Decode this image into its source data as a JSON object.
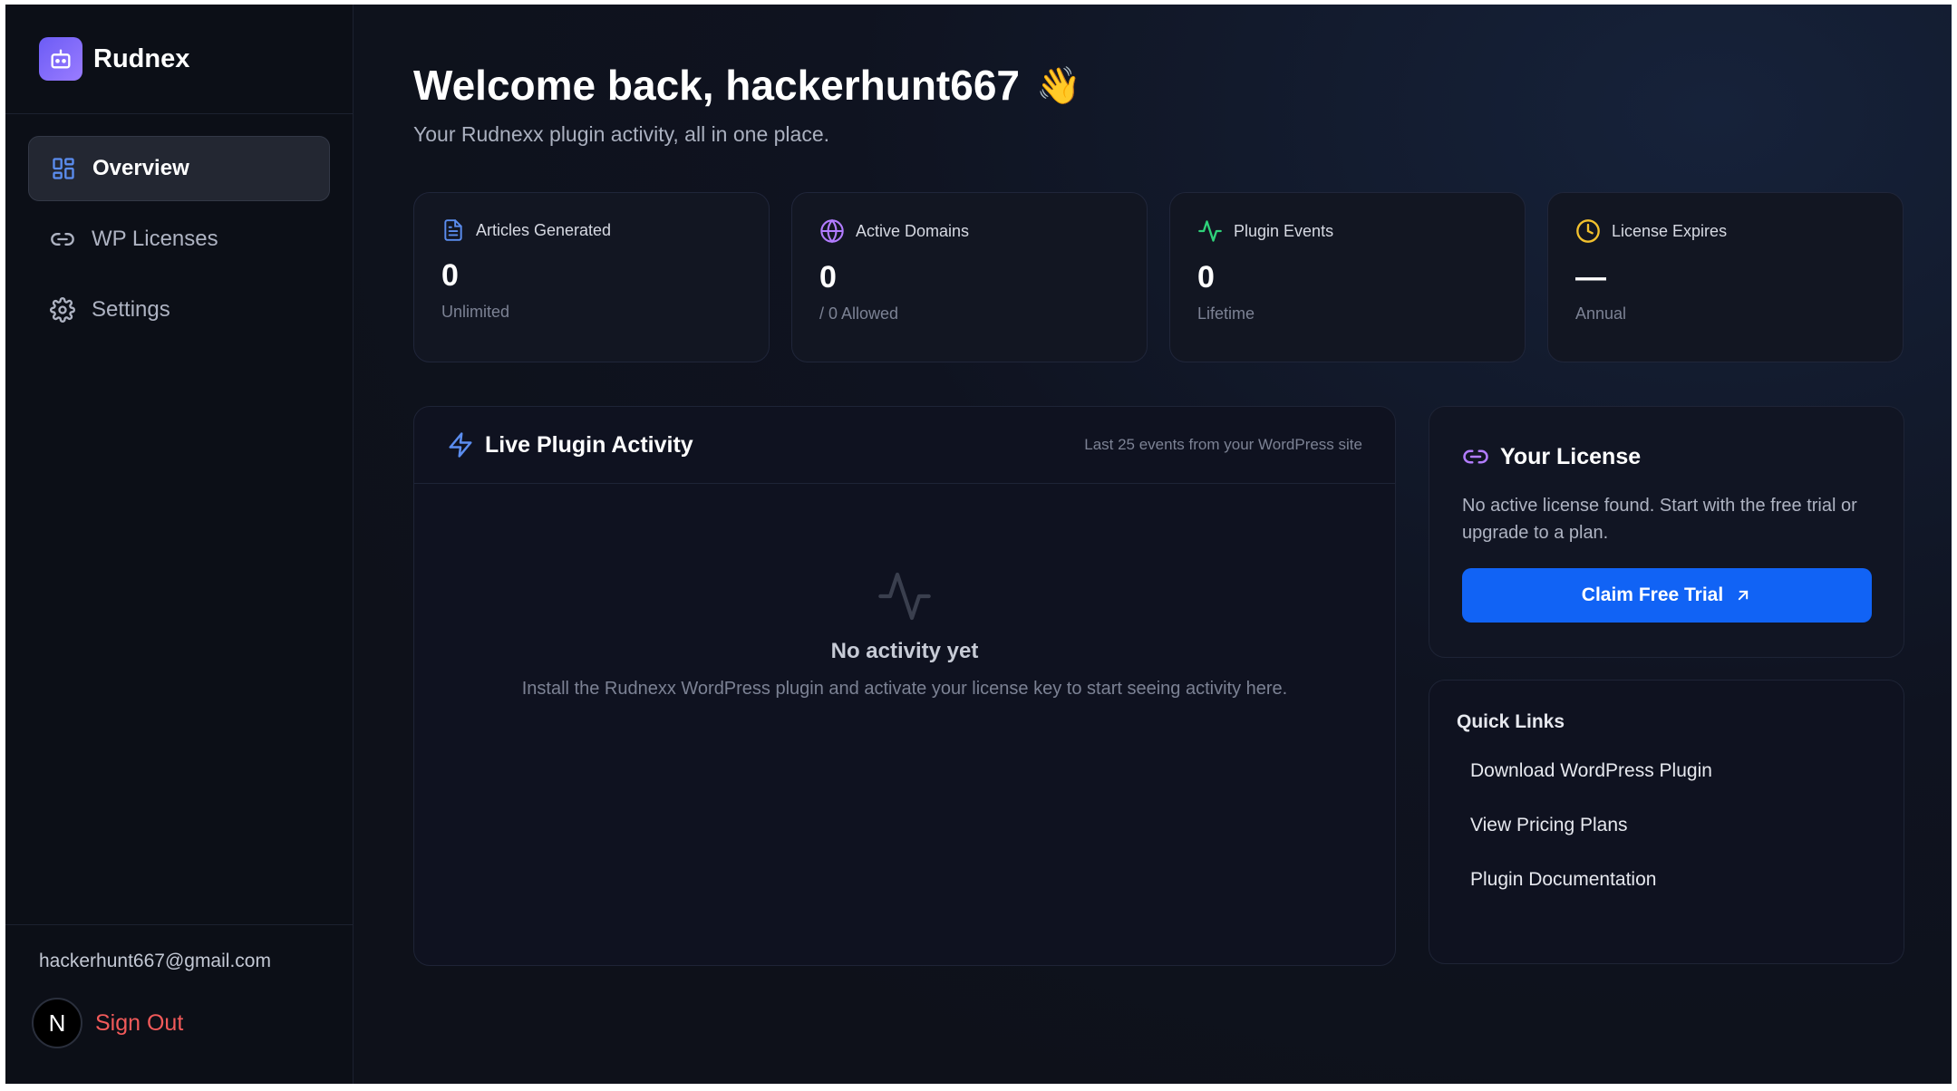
{
  "brand": {
    "name": "Rudnex",
    "logo_icon": "robot-icon",
    "accent": "#7b68f7"
  },
  "nav": [
    {
      "label": "Overview",
      "icon": "dashboard-grid-icon",
      "active": true
    },
    {
      "label": "WP Licenses",
      "icon": "link-icon",
      "active": false
    },
    {
      "label": "Settings",
      "icon": "gear-icon",
      "active": false
    }
  ],
  "user": {
    "email": "hackerhunt667@gmail.com",
    "avatar_letter": "N",
    "signout_label": "Sign Out"
  },
  "header": {
    "title": "Welcome back, hackerhunt667",
    "wave": "👋",
    "subtitle": "Your Rudnexx plugin activity, all in one place."
  },
  "stats": [
    {
      "label": "Articles Generated",
      "value": "0",
      "sub": "Unlimited",
      "icon": "document-icon",
      "color": "#5b8def"
    },
    {
      "label": "Active Domains",
      "value": "0",
      "sub": "/ 0 Allowed",
      "icon": "globe-icon",
      "color": "#b27cff"
    },
    {
      "label": "Plugin Events",
      "value": "0",
      "sub": "Lifetime",
      "icon": "pulse-icon",
      "color": "#2fd27a"
    },
    {
      "label": "License Expires",
      "value": "—",
      "sub": "Annual",
      "icon": "clock-icon",
      "color": "#f2c12e"
    }
  ],
  "activity": {
    "title": "Live Plugin Activity",
    "meta": "Last 25 events from your WordPress site",
    "empty_title": "No activity yet",
    "empty_desc": "Install the Rudnexx WordPress plugin and activate your license key to start seeing activity here."
  },
  "license": {
    "title": "Your License",
    "text": "No active license found. Start with the free trial or upgrade to a plan.",
    "button": "Claim Free Trial"
  },
  "quick_links": {
    "title": "Quick Links",
    "items": [
      "Download WordPress Plugin",
      "View Pricing Plans",
      "Plugin Documentation"
    ]
  }
}
